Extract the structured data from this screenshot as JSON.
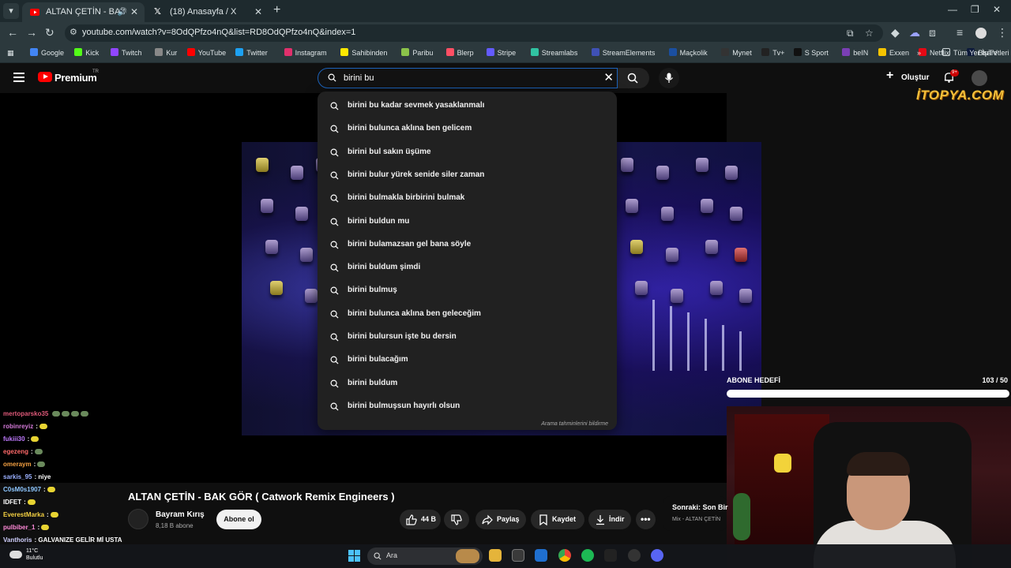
{
  "browser": {
    "tabs": [
      {
        "title": "ALTAN ÇETİN - BAK GÖR ( C",
        "active": true
      },
      {
        "title": "(18) Anasayfa / X",
        "active": false
      }
    ],
    "url": "youtube.com/watch?v=8OdQPfzo4nQ&list=RD8OdQPfzo4nQ&index=1",
    "bookmarks": [
      {
        "label": "Google",
        "color": "#4285f4"
      },
      {
        "label": "Kick",
        "color": "#53fc18"
      },
      {
        "label": "Twitch",
        "color": "#9146ff"
      },
      {
        "label": "Kur",
        "color": "#888888"
      },
      {
        "label": "YouTube",
        "color": "#ff0000"
      },
      {
        "label": "Twitter",
        "color": "#1da1f2"
      },
      {
        "label": "Instagram",
        "color": "#e1306c"
      },
      {
        "label": "Sahibinden",
        "color": "#ffe800"
      },
      {
        "label": "Paribu",
        "color": "#8bc34a"
      },
      {
        "label": "Blerp",
        "color": "#ff4f64"
      },
      {
        "label": "Stripe",
        "color": "#635bff"
      },
      {
        "label": "Streamlabs",
        "color": "#31c3a2"
      },
      {
        "label": "StreamElements",
        "color": "#3f51b5"
      },
      {
        "label": "Maçkolik",
        "color": "#1b4fa0"
      },
      {
        "label": "Mynet",
        "color": "#333333"
      },
      {
        "label": "Tv+",
        "color": "#222222"
      },
      {
        "label": "S Sport",
        "color": "#111111"
      },
      {
        "label": "beIN",
        "color": "#7a3fb5"
      },
      {
        "label": "Exxen",
        "color": "#f5c400"
      },
      {
        "label": "Netflix",
        "color": "#e50914"
      },
      {
        "label": "BluTV",
        "color": "#0d1a3a"
      }
    ],
    "bookmarks_folder": "Tüm Yer İşaretleri"
  },
  "youtube": {
    "brand": "Premium",
    "region": "TR",
    "search_value": "birini bu",
    "create_label": "Oluştur",
    "notif_count": "9+",
    "suggestions": [
      "birini bu kadar sevmek yasaklanmalı",
      "birini bulunca aklına ben gelicem",
      "birini bul sakın üşüme",
      "birini bulur yürek senide siler zaman",
      "birini bulmakla birbirini bulmak",
      "birini buldun mu",
      "birini bulamazsan gel bana söyle",
      "birini buldum şimdi",
      "birini bulmuş",
      "birini bulunca aklına ben geleceğim",
      "birini bulursun işte bu dersin",
      "birini bulacağım",
      "birini buldum",
      "birini bulmuşsun hayırlı olsun"
    ],
    "report_label": "Arama tahminlerini bildirme",
    "video_title": "ALTAN ÇETİN - BAK GÖR ( Catwork Remix Engineers )",
    "channel_name": "Bayram Kırış",
    "channel_subs": "8,18 B abone",
    "subscribe_label": "Abone ol",
    "likes": "44 B",
    "share_label": "Paylaş",
    "save_label": "Kaydet",
    "download_label": "İndir",
    "up_next_title": "Sonraki: Son Bir",
    "up_next_sub": "Mix - ALTAN ÇETİN"
  },
  "stream_overlay": {
    "sponsor": "İTOPYA.COM",
    "goal_title": "ABONE HEDEFİ",
    "goal_count": "103 / 50",
    "goal_progress": 1.0,
    "chat": [
      {
        "user": "mertoparsko35",
        "color": "#e05a7a",
        "msg": "",
        "emotes": [
          "g",
          "g",
          "g",
          "g"
        ]
      },
      {
        "user": "robinreyiz",
        "color": "#d47ad8",
        "msg": ":",
        "emotes": [
          "y"
        ]
      },
      {
        "user": "fukiii30",
        "color": "#c07aff",
        "msg": ":",
        "emotes": [
          "y"
        ]
      },
      {
        "user": "egezeng",
        "color": "#ff6a6a",
        "msg": ":",
        "emotes": [
          "g"
        ]
      },
      {
        "user": "omeraym",
        "color": "#f5a142",
        "msg": ":",
        "emotes": [
          "g"
        ]
      },
      {
        "user": "sarkis_95",
        "color": "#9ab0ff",
        "msg": ": niye",
        "emotes": []
      },
      {
        "user": "C0sM0s1907",
        "color": "#8ec7ff",
        "msg": ":",
        "emotes": [
          "y"
        ]
      },
      {
        "user": "IDFET",
        "color": "#ffffff",
        "msg": ":",
        "emotes": [
          "y"
        ]
      },
      {
        "user": "EverestMarka",
        "color": "#f5d142",
        "msg": ":",
        "emotes": [
          "y"
        ]
      },
      {
        "user": "pulbiber_1",
        "color": "#ff8ad8",
        "msg": ":",
        "emotes": [
          "y"
        ]
      },
      {
        "user": "Vanthoris",
        "color": "#d0d0ff",
        "msg": ": GALVANIZE GELİR Mİ USTA",
        "emotes": []
      }
    ]
  },
  "taskbar": {
    "temp": "11°C",
    "weather": "Bulutlu",
    "search_label": "Ara"
  }
}
